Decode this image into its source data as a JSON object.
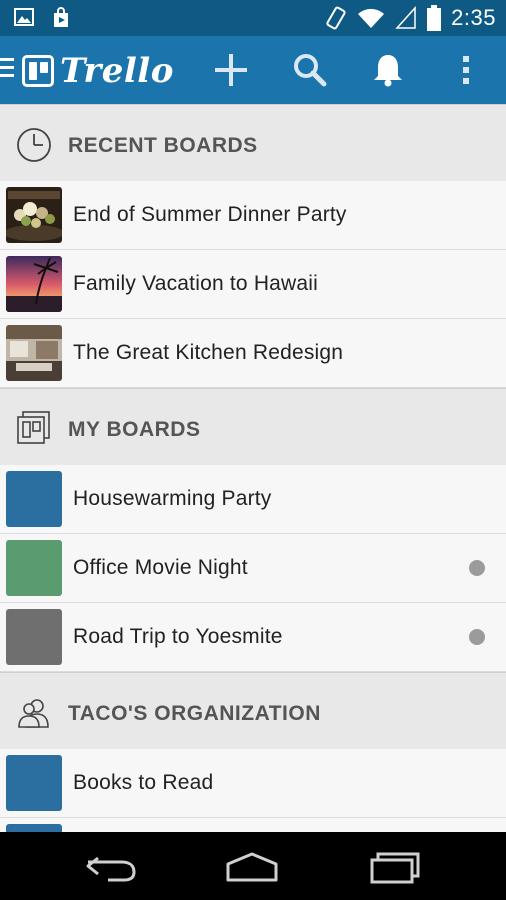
{
  "status_bar": {
    "time": "2:35",
    "icons": [
      "image-icon",
      "play-store-icon",
      "rotate-icon",
      "wifi-icon",
      "signal-icon",
      "battery-icon"
    ]
  },
  "app_bar": {
    "logo_text": "Trello",
    "actions": [
      "add-icon",
      "search-icon",
      "notifications-icon",
      "overflow-menu-icon"
    ],
    "color": "#1b74ac"
  },
  "sections": {
    "recent": {
      "title": "RECENT BOARDS",
      "boards": [
        {
          "name": "End of Summer Dinner Party",
          "thumb": "dinner"
        },
        {
          "name": "Family Vacation to Hawaii",
          "thumb": "sunset"
        },
        {
          "name": "The Great Kitchen Redesign",
          "thumb": "kitchen"
        }
      ]
    },
    "my": {
      "title": "MY BOARDS",
      "boards": [
        {
          "name": "Housewarming Party",
          "color": "#2a6fa0",
          "unread": false
        },
        {
          "name": "Office Movie Night",
          "color": "#5a9b70",
          "unread": true
        },
        {
          "name": "Road Trip to Yoesmite",
          "color": "#6f6f6f",
          "unread": true
        }
      ]
    },
    "org": {
      "title": "TACO'S ORGANIZATION",
      "boards": [
        {
          "name": "Books to Read",
          "color": "#2a6fa0",
          "unread": false
        },
        {
          "name": "",
          "color": "#2a6fa0",
          "unread": false
        }
      ]
    }
  },
  "nav_bar": {
    "buttons": [
      "back-icon",
      "home-icon",
      "recents-icon"
    ]
  }
}
